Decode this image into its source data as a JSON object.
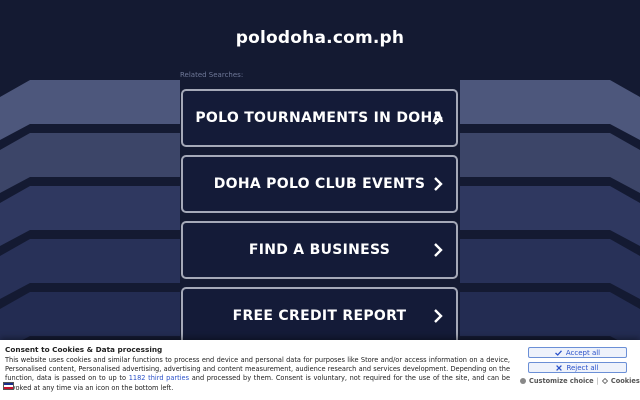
{
  "site": {
    "title": "polodoha.com.ph"
  },
  "related_label": "Related Searches:",
  "searches": [
    {
      "label": "POLO TOURNAMENTS IN DOHA",
      "icon": "chevron-right-icon"
    },
    {
      "label": "DOHA POLO CLUB EVENTS",
      "icon": "chevron-right-icon"
    },
    {
      "label": "FIND A BUSINESS",
      "icon": "chevron-right-icon"
    },
    {
      "label": "FREE CREDIT REPORT",
      "icon": "chevron-right-icon"
    }
  ],
  "consent": {
    "title": "Consent to Cookies & Data processing",
    "text_before_link": "This website uses cookies and similar functions to process end device and personal data for purposes like Store and/or access information on a device, Personalised content, Personalised advertising, advertising and content measurement, audience research and services development. Depending on the function, data is passed on to up to ",
    "link_text": "1182 third parties",
    "text_after_link": " and processed by them. Consent is voluntary, not required for the use of the site, and can be revoked at any time via an icon on the bottom left.",
    "accept_label": "Accept all",
    "reject_label": "Reject all",
    "customize_label": "Customize choice",
    "cookies_label": "Cookies",
    "separator": "|"
  },
  "colors": {
    "background": "#141a32",
    "button_bg": "#141b38",
    "button_border": "#a5a9b8",
    "accent_link": "#2b52c9"
  }
}
